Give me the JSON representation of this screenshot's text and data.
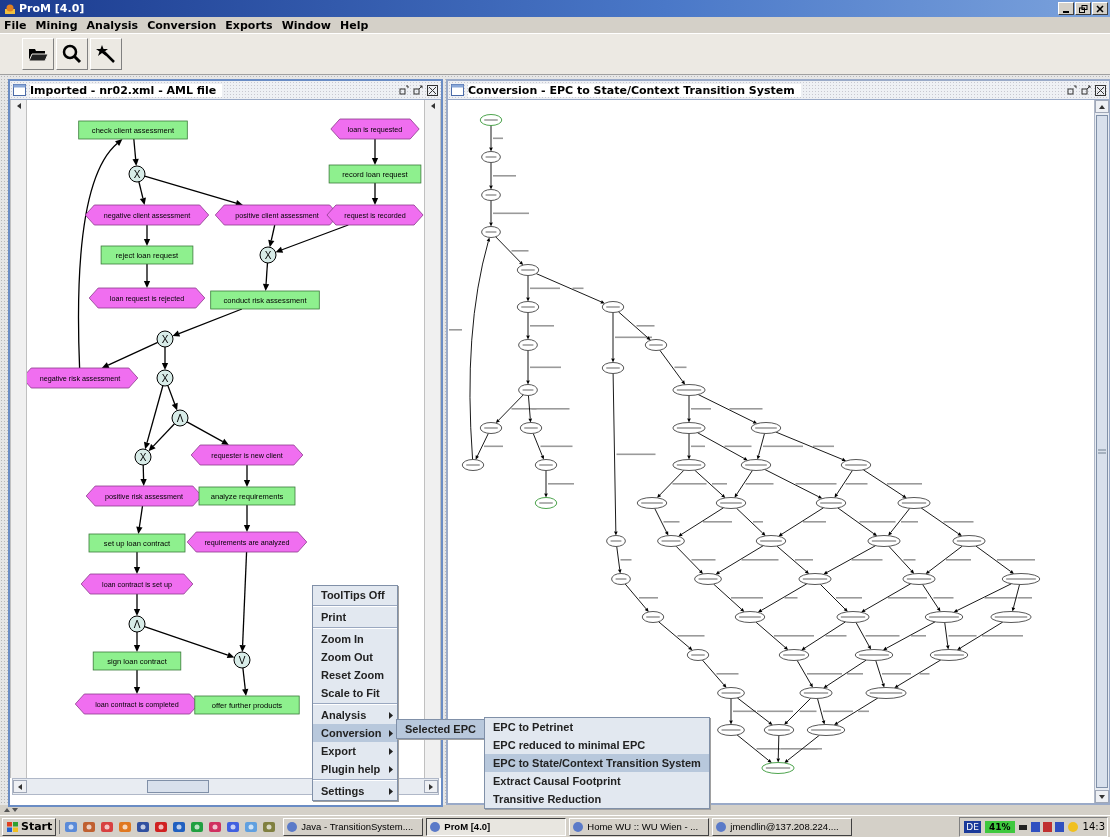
{
  "window": {
    "title": "ProM [4.0]"
  },
  "menu_bar": [
    "File",
    "Mining",
    "Analysis",
    "Conversion",
    "Exports",
    "Window",
    "Help"
  ],
  "epc_frame": {
    "title": "Imported - nr02.xml - AML file",
    "nodes": [
      {
        "kind": "function",
        "label": "check client assessment"
      },
      {
        "kind": "event",
        "label": "loan is requested"
      },
      {
        "kind": "connector",
        "label": "X"
      },
      {
        "kind": "function",
        "label": "record loan request"
      },
      {
        "kind": "event",
        "label": "negative client assessment"
      },
      {
        "kind": "event",
        "label": "positive client assessment"
      },
      {
        "kind": "event",
        "label": "request is recorded"
      },
      {
        "kind": "function",
        "label": "reject loan request"
      },
      {
        "kind": "connector",
        "label": "X"
      },
      {
        "kind": "event",
        "label": "loan request is rejected"
      },
      {
        "kind": "function",
        "label": "conduct risk assessment"
      },
      {
        "kind": "connector",
        "label": "X"
      },
      {
        "kind": "event",
        "label": "negative risk assessment"
      },
      {
        "kind": "connector",
        "label": "X"
      },
      {
        "kind": "connector",
        "label": "Λ"
      },
      {
        "kind": "connector",
        "label": "X"
      },
      {
        "kind": "event",
        "label": "requester is new client"
      },
      {
        "kind": "event",
        "label": "positive risk assessment"
      },
      {
        "kind": "function",
        "label": "analyze requirements"
      },
      {
        "kind": "function",
        "label": "set up loan contract"
      },
      {
        "kind": "event",
        "label": "requirements are analyzed"
      },
      {
        "kind": "event",
        "label": "loan contract is set up"
      },
      {
        "kind": "connector",
        "label": "Λ"
      },
      {
        "kind": "function",
        "label": "sign loan contract"
      },
      {
        "kind": "connector",
        "label": "V"
      },
      {
        "kind": "event",
        "label": "loan contract is completed"
      },
      {
        "kind": "function",
        "label": "offer further products"
      }
    ]
  },
  "ts_frame": {
    "title": "Conversion - EPC to State/Context Transition System"
  },
  "context_menu": {
    "items": [
      {
        "kind": "item",
        "label": "ToolTips Off",
        "selected": false
      },
      {
        "kind": "separator"
      },
      {
        "kind": "item",
        "label": "Print",
        "selected": false
      },
      {
        "kind": "separator"
      },
      {
        "kind": "item",
        "label": "Zoom In",
        "selected": false
      },
      {
        "kind": "item",
        "label": "Zoom Out",
        "selected": false
      },
      {
        "kind": "item",
        "label": "Reset Zoom",
        "selected": false
      },
      {
        "kind": "item",
        "label": "Scale to Fit",
        "selected": false
      },
      {
        "kind": "separator"
      },
      {
        "kind": "submenu",
        "label": "Analysis",
        "selected": false
      },
      {
        "kind": "submenu",
        "label": "Conversion",
        "selected": true
      },
      {
        "kind": "submenu",
        "label": "Export",
        "selected": false
      },
      {
        "kind": "submenu",
        "label": "Plugin help",
        "selected": false
      },
      {
        "kind": "separator"
      },
      {
        "kind": "submenu",
        "label": "Settings",
        "selected": false
      }
    ]
  },
  "submenu": {
    "items": [
      {
        "kind": "submenu",
        "label": "Selected EPC",
        "selected": true
      }
    ]
  },
  "submenu_2": {
    "items": [
      {
        "kind": "item",
        "label": "EPC to Petrinet",
        "selected": false
      },
      {
        "kind": "item",
        "label": "EPC reduced to minimal EPC",
        "selected": false
      },
      {
        "kind": "item",
        "label": "EPC to State/Context Transition System",
        "selected": true
      },
      {
        "kind": "item",
        "label": "Extract Causal Footprint",
        "selected": false
      },
      {
        "kind": "item",
        "label": "Transitive Reduction",
        "selected": false
      }
    ]
  },
  "taskbar": {
    "start": "Start",
    "tasks": [
      {
        "label": "Java - TransitionSystem....",
        "selected": false
      },
      {
        "label": "ProM [4.0]",
        "selected": true
      },
      {
        "label": "Home WU :: WU Wien - ...",
        "selected": false
      },
      {
        "label": "jmendlin@137.208.224....",
        "selected": false
      }
    ],
    "language": "DE",
    "battery": "41%",
    "clock": "14:3"
  }
}
